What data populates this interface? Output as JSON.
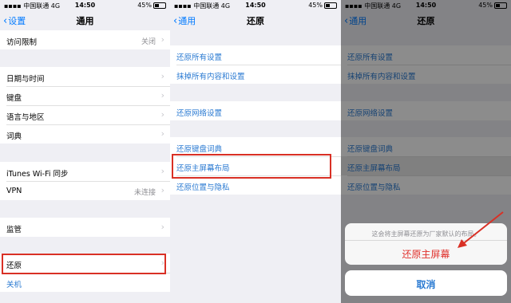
{
  "status": {
    "carrier": "中国联通",
    "network": "4G",
    "time": "14:50",
    "battery": "45%"
  },
  "panel1": {
    "nav_title": "通用",
    "back_label": "设置",
    "rows": [
      {
        "label": "访问限制",
        "value": "关闭"
      },
      {
        "label": "日期与时间"
      },
      {
        "label": "键盘"
      },
      {
        "label": "语言与地区"
      },
      {
        "label": "词典"
      },
      {
        "label": "iTunes Wi-Fi 同步"
      },
      {
        "label": "VPN",
        "value": "未连接"
      },
      {
        "label": "监管"
      },
      {
        "label": "还原"
      },
      {
        "label": "关机"
      }
    ]
  },
  "panel2": {
    "nav_title": "还原",
    "back_label": "通用",
    "rows": [
      {
        "label": "还原所有设置"
      },
      {
        "label": "抹掉所有内容和设置"
      },
      {
        "label": "还原网络设置"
      },
      {
        "label": "还原键盘词典"
      },
      {
        "label": "还原主屏幕布局"
      },
      {
        "label": "还原位置与隐私"
      }
    ]
  },
  "panel3": {
    "nav_title": "还原",
    "back_label": "通用",
    "rows": [
      {
        "label": "还原所有设置"
      },
      {
        "label": "抹掉所有内容和设置"
      },
      {
        "label": "还原网络设置"
      },
      {
        "label": "还原键盘词典"
      },
      {
        "label": "还原主屏幕布局"
      },
      {
        "label": "还原位置与隐私"
      }
    ],
    "sheet": {
      "message": "这会将主屏幕还原为厂家默认的布局。",
      "action": "还原主屏幕",
      "cancel": "取消"
    }
  },
  "colors": {
    "accent": "#2a7ad2",
    "highlight": "#d93025",
    "destructive": "#e0312c"
  }
}
